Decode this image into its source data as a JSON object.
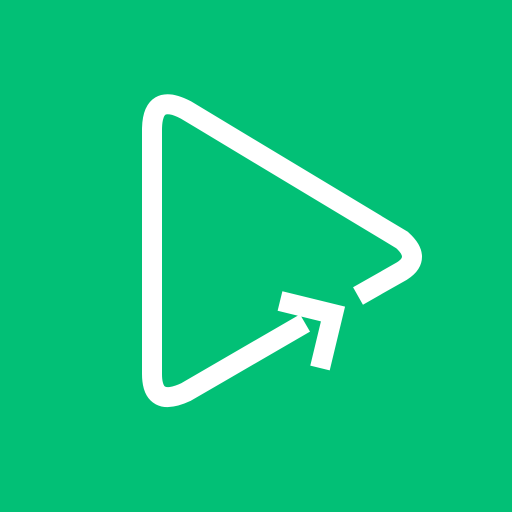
{
  "icon": {
    "name": "play-share-icon",
    "background_color": "#02C076",
    "foreground_color": "#FFFFFF"
  }
}
